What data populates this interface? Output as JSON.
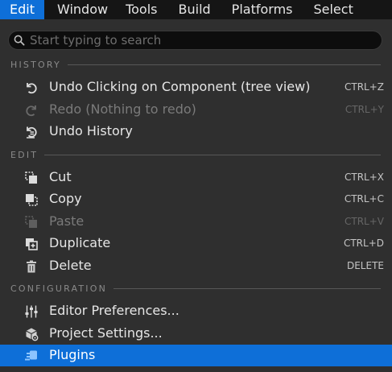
{
  "menubar": {
    "items": [
      {
        "label": "Edit",
        "active": true
      },
      {
        "label": "Window"
      },
      {
        "label": "Tools"
      },
      {
        "label": "Build"
      },
      {
        "label": "Platforms"
      },
      {
        "label": "Select"
      }
    ]
  },
  "search": {
    "placeholder": "Start typing to search",
    "value": ""
  },
  "sections": {
    "history": "HISTORY",
    "edit": "EDIT",
    "configuration": "CONFIGURATION"
  },
  "items": {
    "undo": {
      "label": "Undo Clicking on Component (tree view)",
      "shortcut": "CTRL+Z",
      "icon": "undo-icon"
    },
    "redo": {
      "label": "Redo (Nothing to redo)",
      "shortcut": "CTRL+Y",
      "icon": "redo-icon",
      "disabled": true
    },
    "undo_history": {
      "label": "Undo History",
      "icon": "undo-history-icon"
    },
    "cut": {
      "label": "Cut",
      "shortcut": "CTRL+X",
      "icon": "cut-icon"
    },
    "copy": {
      "label": "Copy",
      "shortcut": "CTRL+C",
      "icon": "copy-icon"
    },
    "paste": {
      "label": "Paste",
      "shortcut": "CTRL+V",
      "icon": "paste-icon",
      "disabled": true
    },
    "duplicate": {
      "label": "Duplicate",
      "shortcut": "CTRL+D",
      "icon": "duplicate-icon"
    },
    "delete": {
      "label": "Delete",
      "shortcut": "DELETE",
      "icon": "trash-icon"
    },
    "editor_prefs": {
      "label": "Editor Preferences...",
      "icon": "sliders-icon"
    },
    "project_settings": {
      "label": "Project Settings...",
      "icon": "project-settings-icon"
    },
    "plugins": {
      "label": "Plugins",
      "icon": "plugin-icon",
      "highlighted": true
    }
  },
  "colors": {
    "menubar_bg": "#151515",
    "menu_bg": "#2f2f2f",
    "accent": "#0e6fd8",
    "text": "#e6e6e6",
    "disabled_text": "#7a7a7a"
  }
}
